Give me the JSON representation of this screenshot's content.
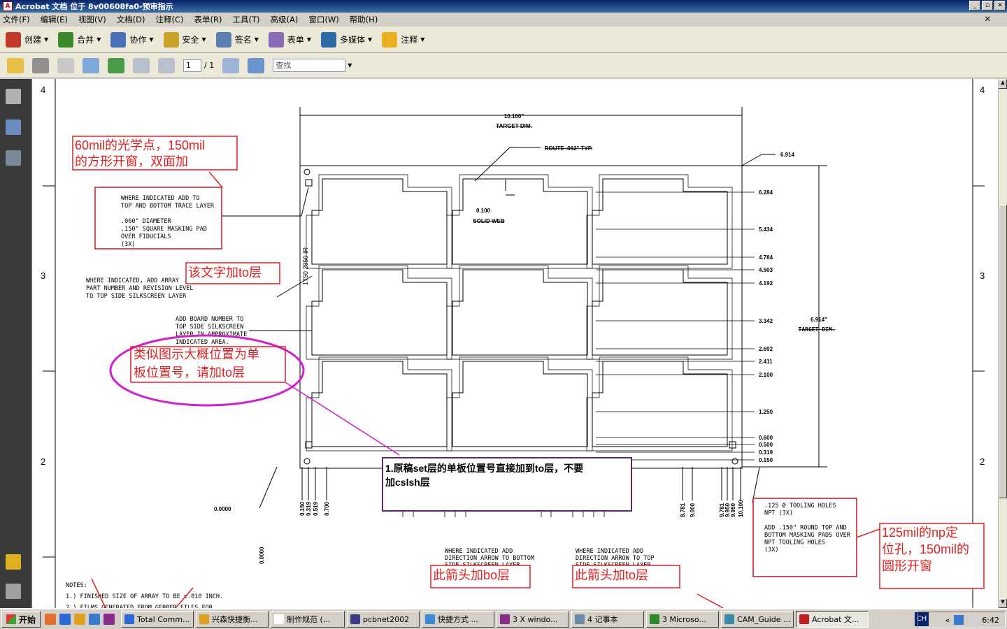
{
  "window": {
    "title": "Acrobat 文档 位于 8v00608fa0-预审指示",
    "min": "_",
    "max": "▫",
    "close": "✕"
  },
  "menu": [
    "文件(F)",
    "编辑(E)",
    "视图(V)",
    "文档(D)",
    "注释(C)",
    "表单(R)",
    "工具(T)",
    "高级(A)",
    "窗口(W)",
    "帮助(H)"
  ],
  "menu_close": "✕",
  "toolbar1": [
    {
      "label": "创建",
      "icon": "create-pdf-icon",
      "color": "#c0392b"
    },
    {
      "label": "合并",
      "icon": "combine-icon",
      "color": "#3a8a2a"
    },
    {
      "label": "协作",
      "icon": "collaborate-icon",
      "color": "#4b6fb6"
    },
    {
      "label": "安全",
      "icon": "lock-icon",
      "color": "#c9a227"
    },
    {
      "label": "签名",
      "icon": "pen-icon",
      "color": "#5a7fb0"
    },
    {
      "label": "表单",
      "icon": "form-icon",
      "color": "#8a6ab8"
    },
    {
      "label": "多媒体",
      "icon": "multimedia-icon",
      "color": "#2d6aa8"
    },
    {
      "label": "注释",
      "icon": "comment-icon",
      "color": "#e8b020"
    }
  ],
  "toolbar2": {
    "page_current": "1",
    "page_total": "/ 1",
    "search_placeholder": "查找"
  },
  "drawing": {
    "ruler_left": [
      "4",
      "3",
      "2"
    ],
    "ruler_right": [
      "4",
      "3",
      "2"
    ],
    "dim_top": "10.100\"",
    "dim_top_sub": "TARGET DIM.",
    "route": "ROUTE .062\" TYP.",
    "web_val": "0.100",
    "web_label": "SOLID WEB",
    "dim_right_total": "6.914",
    "dim_right_big": "6.914\"",
    "dim_right_big_sub": "TARGET DIM.",
    "right_dims": [
      "6.284",
      "5.434",
      "4.784",
      "4.503",
      "4.192",
      "3.342",
      "2.692",
      "2.411",
      "2.100",
      "1.250",
      "0.600",
      "0.500",
      "0.319",
      "0.150"
    ],
    "bottom_left_dims": [
      "0.150",
      "0.319",
      "0.519",
      "0.700"
    ],
    "bottom_right_dims": [
      "8.781",
      "9.000",
      "9.781",
      "9.950",
      "9.950",
      "10.100"
    ],
    "origin_x": "0.0000",
    "origin_y": "0.0000",
    "vertical_text": "1750 2850 IR",
    "note_fiducial": [
      "WHERE INDICATED ADD TO",
      "TOP AND BOTTOM TRACE LAYER",
      "",
      ".060\" DIAMETER",
      ".150\" SQUARE MASKING PAD",
      "OVER FIDUCIALS",
      "(3X)"
    ],
    "note_array": [
      "WHERE INDICATED, ADD ARRAY",
      "PART NUMBER AND REVISION LEVEL",
      "TO TOP SIDE SILKSCREEN LAYER"
    ],
    "note_board": [
      "ADD BOARD NUMBER TO",
      "TOP SIDE SILKSCREEN",
      "LAYER IN APPROXIMATE",
      "INDICATED AREA."
    ],
    "note_arrow_bottom": [
      "WHERE INDICATED ADD",
      "DIRECTION ARROW TO BOTTOM",
      "SIDE SILKSCREEN LAYER"
    ],
    "note_arrow_top": [
      "WHERE INDICATED ADD",
      "DIRECTION ARROW TO TOP",
      "SIDE SILKSCREEN LAYER"
    ],
    "note_tooling": [
      ".125 Ø TOOLING HOLES",
      "NPT (3X)",
      "",
      "ADD .150\" ROUND TOP AND",
      "BOTTOM MASKING PADS OVER",
      "NPT TOOLING HOLES",
      "(3X)"
    ],
    "notes": [
      "NOTES:",
      "1.) FINISHED SIZE OF ARRAY TO BE ±.010 INCH.",
      "2.) FILMS GENERATED FROM GERBER FILES FOR"
    ]
  },
  "annotations": {
    "fiducial": [
      "60mil的光学点，150mil",
      "的方形开窗，双面加"
    ],
    "text_to": "该文字加to层",
    "position": [
      "类似图示大概位置为单",
      "板位置号，请加to层"
    ],
    "callout": [
      "1.原稿set层的单板位置号直接加到to层，不要",
      "加cslsh层"
    ],
    "arrow_bo": "此箭头加bo层",
    "arrow_to": "此箭头加to层",
    "np_hole": [
      "125mil的np定",
      "位孔，150mil的",
      "圆形开窗"
    ],
    "colors": {
      "annotation_red": "#e02020",
      "ellipse": "#d020d0",
      "callout_border": "#5a2a6a"
    }
  },
  "taskbar": {
    "start": "开始",
    "tasks": [
      "Total Comm...",
      "兴森快捷衡...",
      "制作规范 (...",
      "pcbnet2002",
      "快捷方式 ...",
      "3 X windo...",
      "4 记事本",
      "3 Microso...",
      "CAM_Guide ...",
      "Acrobat 文..."
    ],
    "lang": "CH",
    "time": "6:42"
  }
}
